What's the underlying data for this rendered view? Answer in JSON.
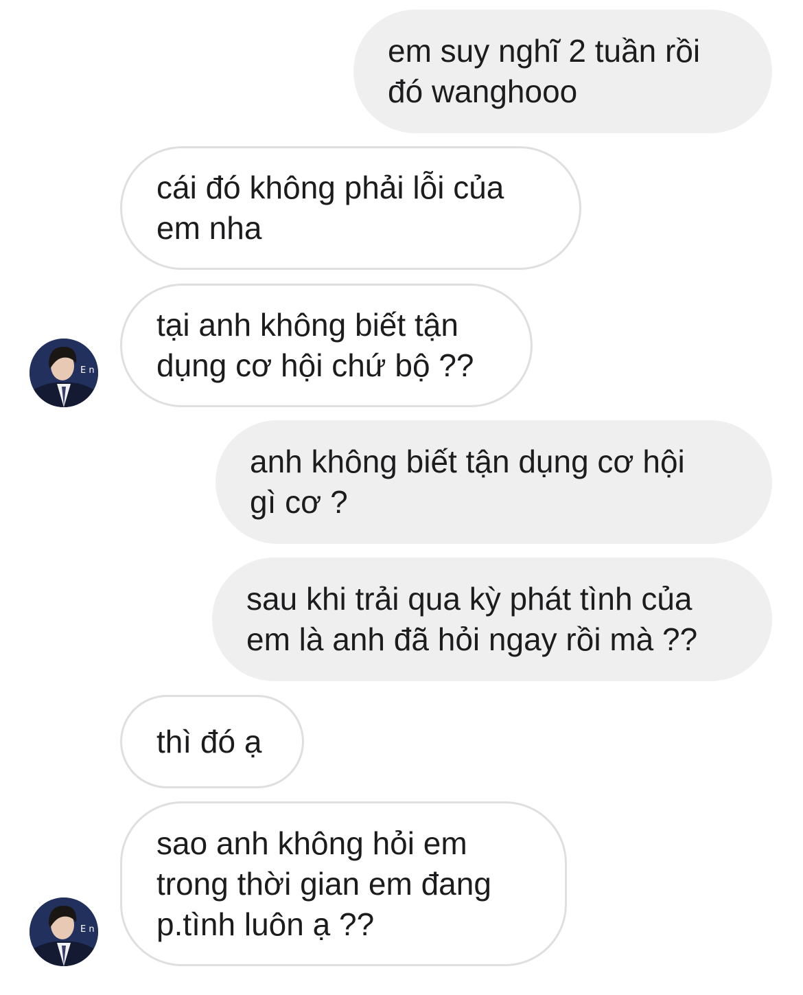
{
  "thread": {
    "messages": [
      {
        "from": "me",
        "text": "em suy nghĩ 2 tuần rồi\nđó wanghooo"
      },
      {
        "from": "them",
        "text": "cái đó không phải lỗi của\nem nha"
      },
      {
        "from": "them",
        "text": "tại anh không biết tận\ndụng cơ hội chứ bộ ??"
      },
      {
        "from": "me",
        "text": "anh không biết tận dụng cơ hội\ngì cơ ?"
      },
      {
        "from": "me",
        "text": "sau khi trải qua kỳ phát tình của\nem là anh đã hỏi ngay rồi mà ??"
      },
      {
        "from": "them",
        "text": "thì đó ạ"
      },
      {
        "from": "them",
        "text": "sao anh không hỏi em\ntrong thời gian em đang\np.tình luôn ạ ??"
      }
    ],
    "avatar_badge": "E n"
  },
  "colors": {
    "sent_bubble": "#efefef",
    "received_bubble_border": "#dfdfdf",
    "avatar_background": "#1f2b55"
  }
}
